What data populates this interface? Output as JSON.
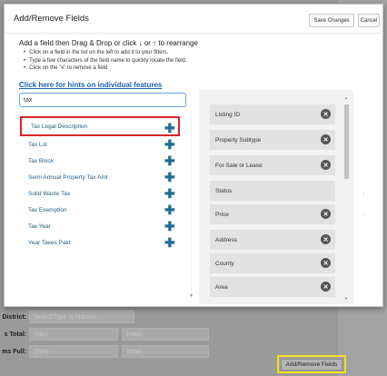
{
  "background": {
    "rows": [
      {
        "label": "District:",
        "value": "Select/Type to Narrow..."
      },
      {
        "label": "s Total:",
        "min": "(min)",
        "max": "(max)"
      },
      {
        "label": "ms Full:",
        "min": "(min)",
        "max": "(max)"
      }
    ],
    "bottom_button": "Add/Remove Fields"
  },
  "dialog": {
    "title": "Add/Remove Fields",
    "save_label": "Save Changes",
    "cancel_label": "Cancel",
    "instructions": {
      "main": "Add a field then Drag & Drop or click ↓ or ↑ to rearrange",
      "bullets": [
        "Click on a field in the list on the left to add it to your filters.",
        "Type a few characters of the field name to quickly locate the field.",
        "Click on the \"x\" to remove a field"
      ]
    },
    "hint_link": "Click here for hints on individual features",
    "search": {
      "value": "tax",
      "placeholder": ""
    },
    "available_fields": [
      "Tax Legal Description",
      "Tax Lot",
      "Tax Block",
      "Semi Annual Property Tax Amt",
      "Solid Waste Tax",
      "Tax Exemption",
      "Tax Year",
      "Year Taxes Paid"
    ],
    "selected_fields": [
      "Listing ID",
      "Property Subtype",
      "For Sale or Lease",
      "Status",
      "Price",
      "Address",
      "County",
      "Area"
    ],
    "removable": [
      true,
      true,
      true,
      false,
      true,
      true,
      true,
      true
    ],
    "plus_symbol": "✚",
    "remove_symbol": "✕",
    "colors": {
      "link": "#1565b7",
      "field_text": "#1c5e86",
      "highlight": "#d9232b",
      "callout": "#f1e21a"
    }
  }
}
